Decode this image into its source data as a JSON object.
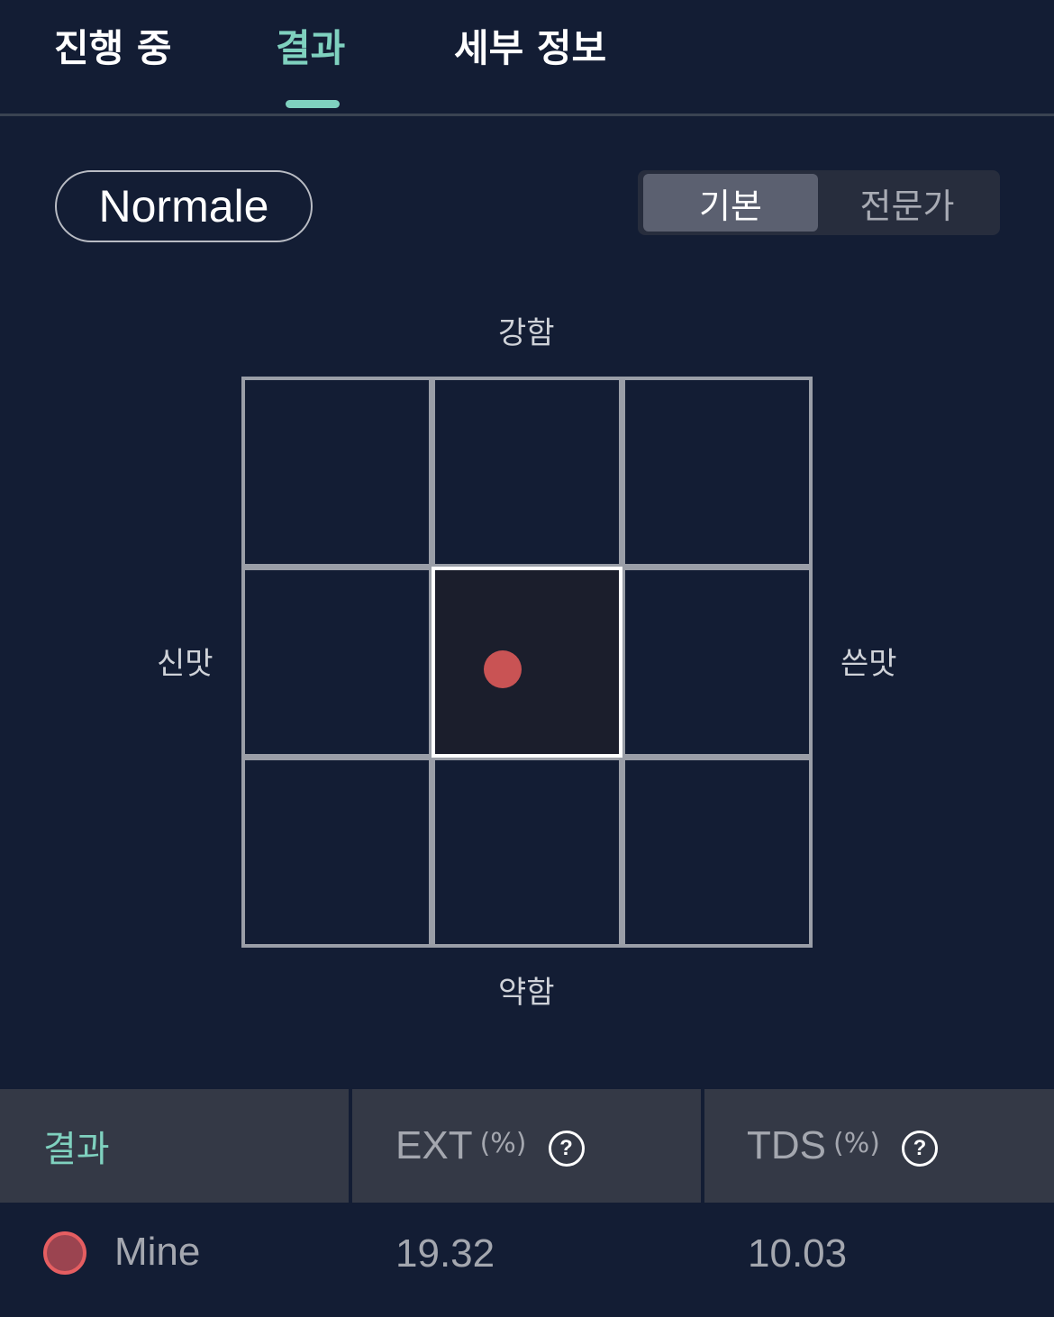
{
  "tabs": [
    {
      "label": "진행 중",
      "active": false
    },
    {
      "label": "결과",
      "active": true
    },
    {
      "label": "세부 정보",
      "active": false
    }
  ],
  "accent_color": "#7fd1bf",
  "profile": {
    "label": "Normale"
  },
  "view_toggle": {
    "options": [
      "기본",
      "전문가"
    ],
    "selected": "기본"
  },
  "taste_grid": {
    "axis_top": "강함",
    "axis_bottom": "약함",
    "axis_left": "신맛",
    "axis_right": "쓴맛",
    "rows": 3,
    "cols": 3,
    "selected_cell": {
      "row": 1,
      "col": 1
    },
    "marker_color": "#c95354"
  },
  "results": {
    "header": {
      "result_label": "결과",
      "ext_label": "EXT",
      "ext_unit": "(%)",
      "tds_label": "TDS",
      "tds_unit": "(%)",
      "help_icon": "?"
    },
    "rows": [
      {
        "name": "Mine",
        "ext": "19.32",
        "tds": "10.03",
        "dot_color": "#e55e61"
      }
    ]
  }
}
